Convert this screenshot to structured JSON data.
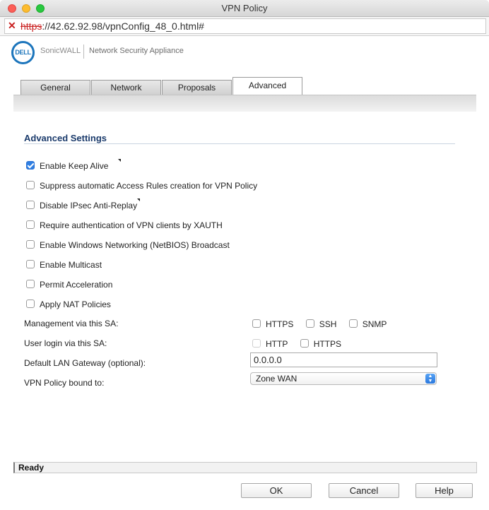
{
  "window": {
    "title": "VPN Policy"
  },
  "address": {
    "scheme": "https",
    "rest": "://42.62.92.98/vpnConfig_48_0.html#"
  },
  "brand": {
    "logo_text": "DELL",
    "product": "SonicWALL",
    "subtitle": "Network Security Appliance"
  },
  "tabs": [
    {
      "label": "General",
      "active": false
    },
    {
      "label": "Network",
      "active": false
    },
    {
      "label": "Proposals",
      "active": false
    },
    {
      "label": "Advanced",
      "active": true
    }
  ],
  "section": {
    "title": "Advanced Settings"
  },
  "options": [
    {
      "label": "Enable Keep Alive",
      "checked": true
    },
    {
      "label": "Suppress automatic Access Rules creation for VPN Policy",
      "checked": false
    },
    {
      "label": "Disable IPsec Anti-Replay",
      "checked": false
    },
    {
      "label": "Require authentication of VPN clients by XAUTH",
      "checked": false
    },
    {
      "label": "Enable Windows Networking (NetBIOS) Broadcast",
      "checked": false
    },
    {
      "label": "Enable Multicast",
      "checked": false
    },
    {
      "label": "Permit Acceleration",
      "checked": false
    },
    {
      "label": "Apply NAT Policies",
      "checked": false
    }
  ],
  "management": {
    "label": "Management via this SA:",
    "items": [
      {
        "label": "HTTPS",
        "checked": false
      },
      {
        "label": "SSH",
        "checked": false
      },
      {
        "label": "SNMP",
        "checked": false
      }
    ]
  },
  "user_login": {
    "label": "User login via this SA:",
    "items": [
      {
        "label": "HTTP",
        "checked": false,
        "disabled": true
      },
      {
        "label": "HTTPS",
        "checked": false,
        "disabled": false
      }
    ]
  },
  "gateway": {
    "label": "Default LAN Gateway (optional):",
    "value": "0.0.0.0"
  },
  "bound_to": {
    "label": "VPN Policy bound to:",
    "value": "Zone WAN"
  },
  "status": {
    "text": "Ready"
  },
  "buttons": {
    "ok": "OK",
    "cancel": "Cancel",
    "help": "Help"
  }
}
